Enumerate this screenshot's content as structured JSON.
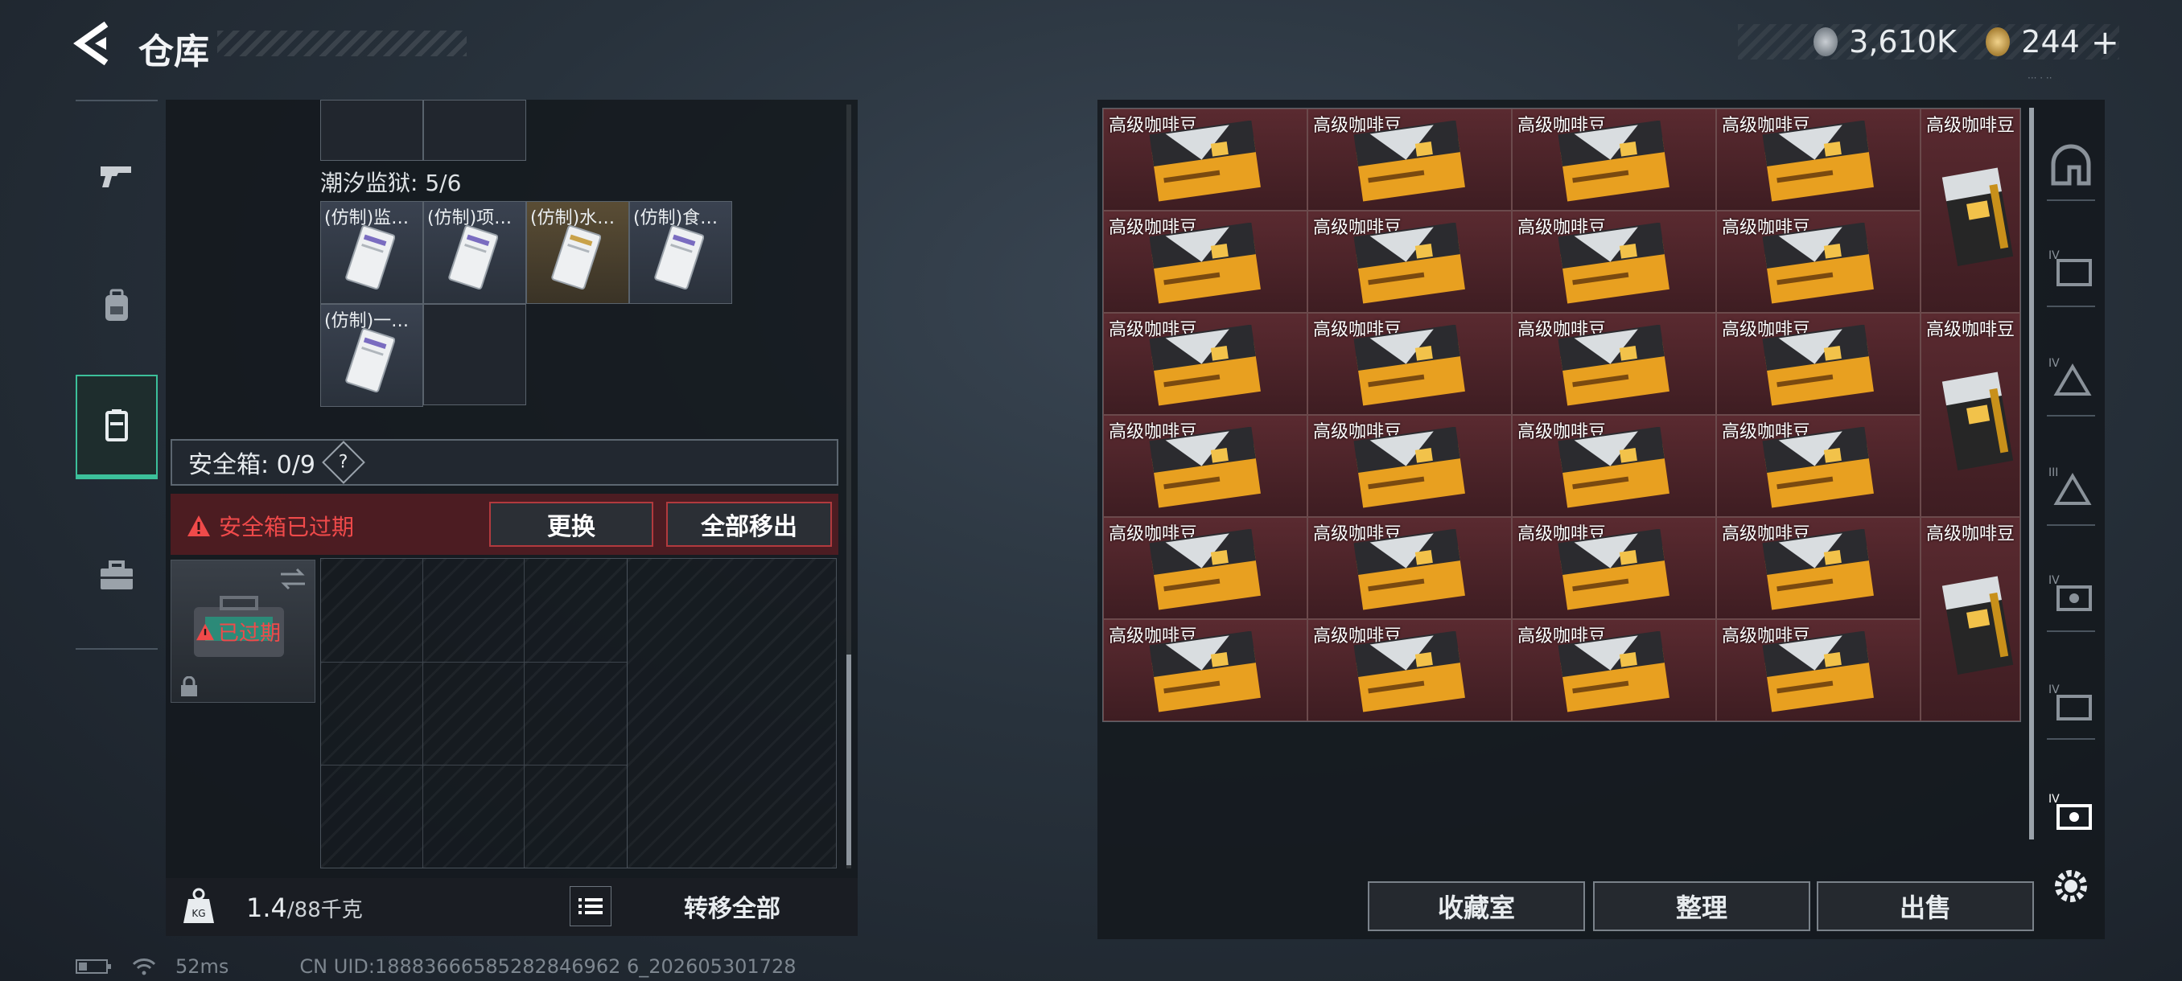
{
  "header": {
    "title": "仓库"
  },
  "currency": {
    "silver": "3,610K",
    "gold": "244",
    "add_label": "+"
  },
  "left_tabs": [
    "weapon-tab",
    "backpack-tab",
    "container-tab",
    "toolbox-tab"
  ],
  "prison": {
    "label": "潮汐监狱: 5/6",
    "items": [
      {
        "label": "(仿制)监…",
        "tint": "gray"
      },
      {
        "label": "(仿制)项…",
        "tint": "gray"
      },
      {
        "label": "(仿制)水…",
        "tint": "gold"
      },
      {
        "label": "(仿制)食…",
        "tint": "gray"
      },
      {
        "label": "(仿制)一…",
        "tint": "gray"
      }
    ]
  },
  "safe_box": {
    "label": "安全箱: 0/9",
    "help": "?",
    "warning": "安全箱已过期",
    "replace_btn": "更换",
    "move_all_btn": "全部移出",
    "expired_label": "已过期"
  },
  "weight": {
    "current": "1.4",
    "max": "/88千克",
    "unit_icon": "KG"
  },
  "transfer_all": "转移全部",
  "stash": {
    "item_label": "高级咖啡豆",
    "rows": 6,
    "cols": 5
  },
  "bottom_buttons": {
    "collection": "收藏室",
    "sort": "整理",
    "sell": "出售"
  },
  "status": {
    "ping": "52ms",
    "uid": "CN UID:18883666585282846962 6_202605301728"
  },
  "colors": {
    "accent": "#3cc09a",
    "warning": "#f04a4a",
    "stash_bg": "#5a2a30"
  }
}
